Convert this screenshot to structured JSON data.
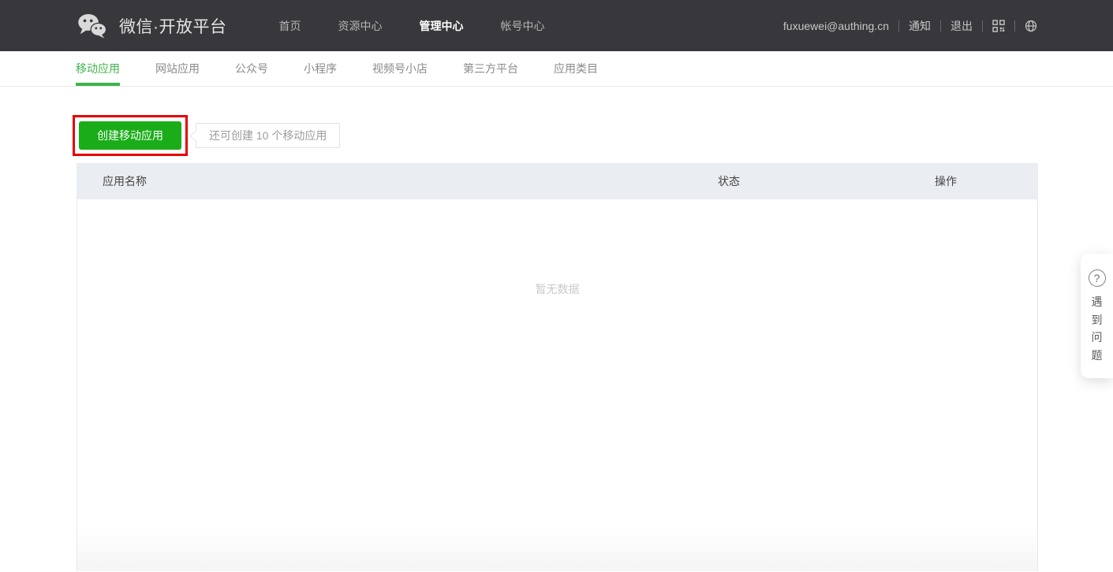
{
  "header": {
    "logo_title": "微信·开放平台",
    "nav_items": [
      {
        "label": "首页"
      },
      {
        "label": "资源中心"
      },
      {
        "label": "管理中心"
      },
      {
        "label": "帐号中心"
      }
    ],
    "user_email": "fuxuewei@authing.cn",
    "notification_label": "通知",
    "logout_label": "退出"
  },
  "tabs": [
    {
      "label": "移动应用"
    },
    {
      "label": "网站应用"
    },
    {
      "label": "公众号"
    },
    {
      "label": "小程序"
    },
    {
      "label": "视频号小店"
    },
    {
      "label": "第三方平台"
    },
    {
      "label": "应用类目"
    }
  ],
  "toolbar": {
    "create_button_label": "创建移动应用",
    "quota_hint": "还可创建 10 个移动应用"
  },
  "table": {
    "columns": [
      "应用名称",
      "状态",
      "操作"
    ],
    "empty_text": "暂无数据"
  },
  "help_widget": {
    "question_glyph": "?",
    "label_chars": [
      "遇",
      "到",
      "问",
      "题"
    ]
  },
  "colors": {
    "header_bg": "#38383c",
    "accent_green": "#1aad19",
    "tab_active_green": "#3eb44a",
    "annotation_red": "#e60000",
    "table_header_bg": "#eaedf1"
  }
}
